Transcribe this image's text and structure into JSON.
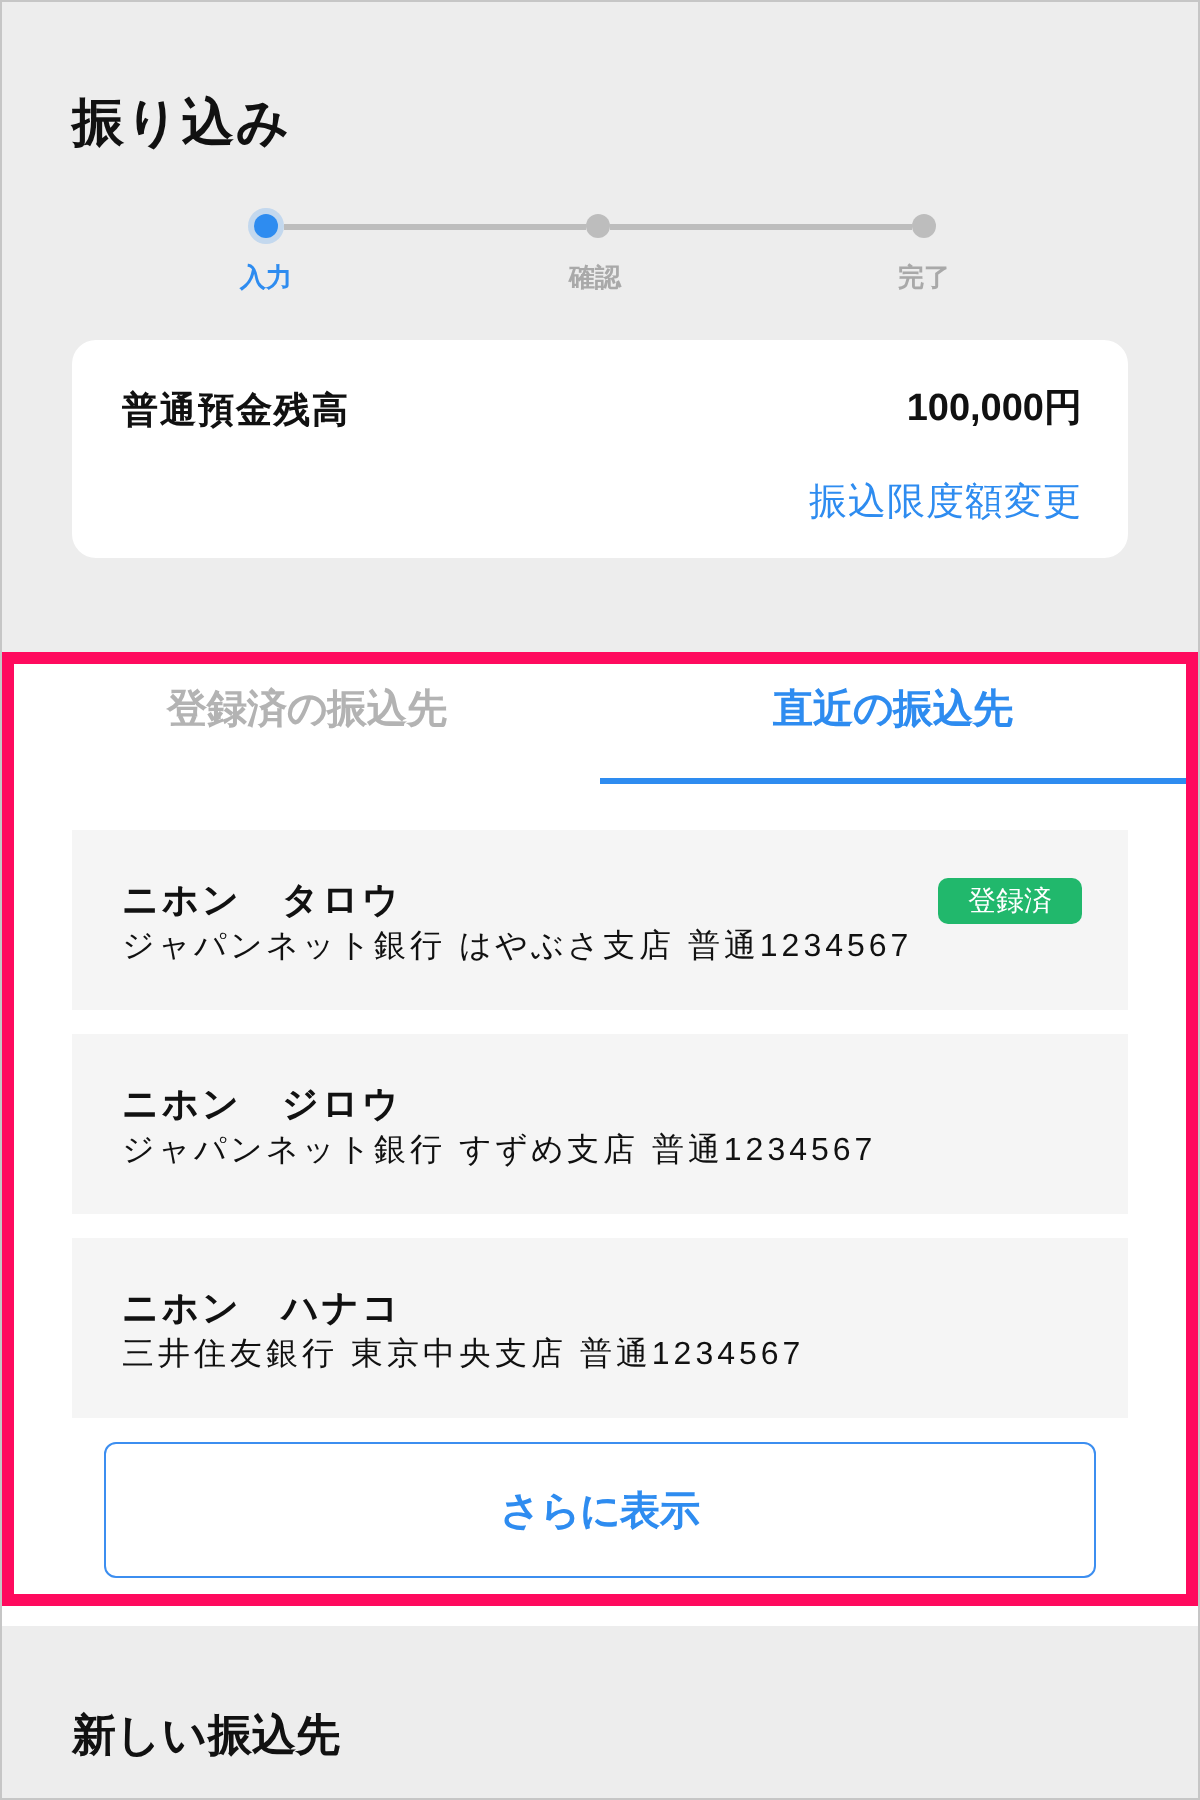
{
  "page": {
    "title": "振り込み"
  },
  "steps": [
    {
      "label": "入力",
      "selected": true
    },
    {
      "label": "確認",
      "selected": false
    },
    {
      "label": "完了",
      "selected": false
    }
  ],
  "balance": {
    "label": "普通預金残高",
    "amount": "100,000円",
    "link": "振込限度額変更"
  },
  "payees": {
    "highlighted": true,
    "tabs": [
      {
        "label": "登録済の振込先",
        "selected": false
      },
      {
        "label": "直近の振込先",
        "selected": true
      }
    ],
    "items": [
      {
        "name": "ニホン　タロウ",
        "account": "ジャパンネット銀行 はやぶさ支店 普通1234567",
        "badge": "登録済"
      },
      {
        "name": "ニホン　ジロウ",
        "account": "ジャパンネット銀行 すずめ支店 普通1234567"
      },
      {
        "name": "ニホン　ハナコ",
        "account": "三井住友銀行 東京中央支店 普通1234567"
      }
    ],
    "more_button": "さらに表示"
  },
  "new_payee": {
    "title": "新しい振込先"
  }
}
